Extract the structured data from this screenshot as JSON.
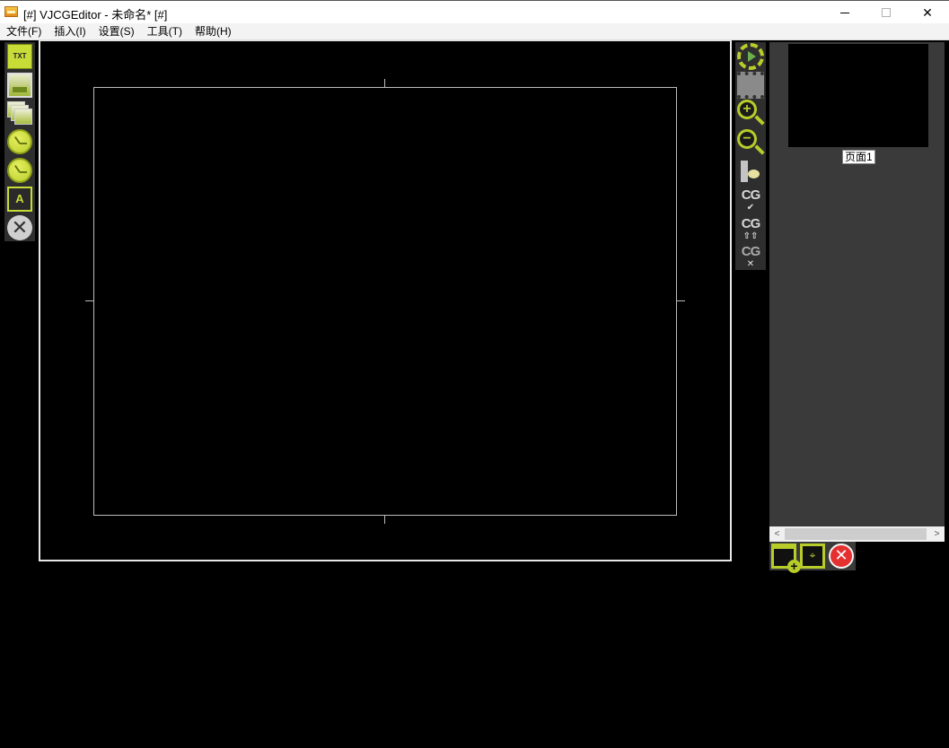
{
  "window": {
    "title": "[#] VJCGEditor - 未命名* [#]",
    "min_glyph": "—",
    "max_glyph": "☐",
    "close_glyph": "✕"
  },
  "menu": {
    "items": [
      "文件(F)",
      "插入(I)",
      "设置(S)",
      "工具(T)",
      "帮助(H)"
    ]
  },
  "left_toolbar": {
    "txt_label": "TXT",
    "text_effect_label": "A",
    "close_glyph": "✕"
  },
  "right_toolbar": {
    "zoom_in_glyph": "+",
    "zoom_out_glyph": "−",
    "cg_label": "CG",
    "cg_check_glyph": "✔",
    "cg_up_glyph": "⇧⇧",
    "cg_remove_glyph": "✕"
  },
  "pages": {
    "items": [
      {
        "label": "页面1"
      }
    ],
    "scroll_left": "<",
    "scroll_right": ">"
  },
  "page_tools": {
    "edit_glyph": "⌖",
    "delete_glyph": "✕"
  },
  "colors": {
    "accent": "#b8cc2a",
    "panel": "#3a3a3a",
    "toolbar": "#2e2e2e",
    "canvas_border": "#e8e8e8",
    "delete_red": "#e53030"
  }
}
